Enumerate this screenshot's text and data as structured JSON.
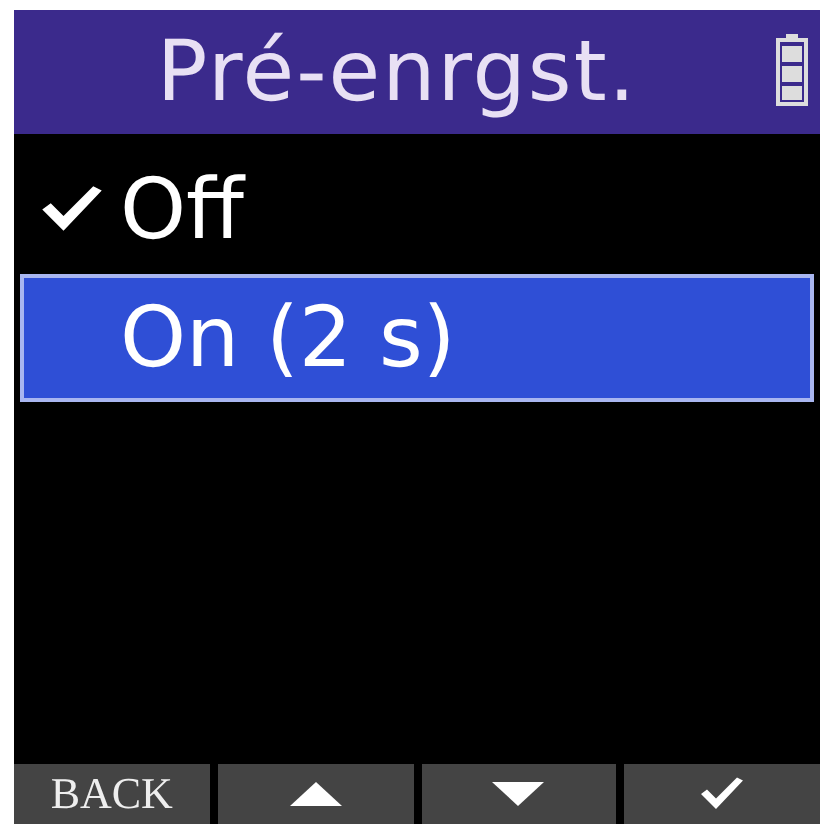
{
  "title": "Pré-enrgst.",
  "options": [
    {
      "label": "Off",
      "checked": true,
      "selected": false
    },
    {
      "label": "On (2 s)",
      "checked": false,
      "selected": true
    }
  ],
  "softkeys": [
    {
      "kind": "text",
      "label": "BACK"
    },
    {
      "kind": "up"
    },
    {
      "kind": "down"
    },
    {
      "kind": "confirm"
    }
  ]
}
